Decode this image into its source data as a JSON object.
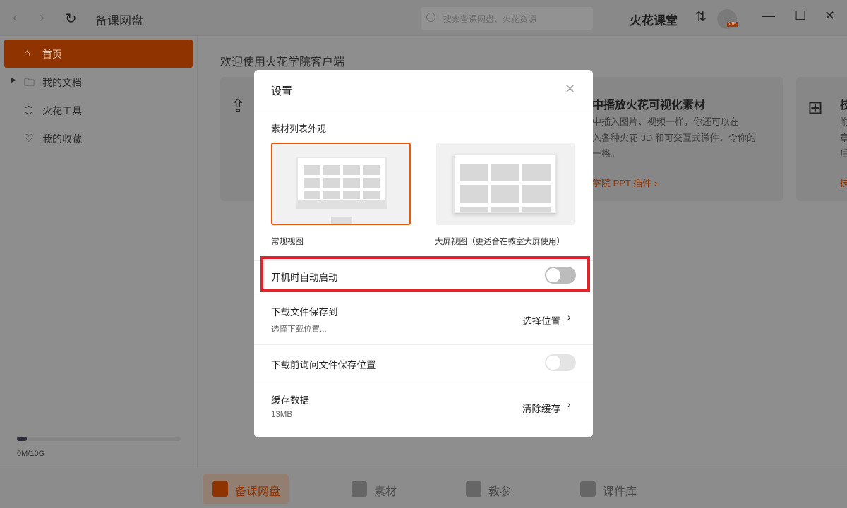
{
  "topbar": {
    "title": "备课网盘",
    "search_placeholder": "搜索备课网盘、火花资源",
    "brand": "火花课堂",
    "vip": "VIP"
  },
  "sidebar": {
    "items": [
      {
        "label": "首页",
        "icon": "home-icon",
        "active": true
      },
      {
        "label": "我的文档",
        "icon": "folder-icon"
      },
      {
        "label": "火花工具",
        "icon": "cube-icon"
      },
      {
        "label": "我的收藏",
        "icon": "heart-icon"
      }
    ],
    "storage": {
      "used_fraction": 0.02,
      "text": "0M/10G"
    }
  },
  "main": {
    "welcome": "欢迎使用火花学院客户端",
    "card1": {
      "title": "中播放火花可视化素材",
      "lines": [
        "中插入图片、视频一样，你还可以在",
        "入各种火花 3D 和可交互式微件，令你的",
        "一格。"
      ],
      "link": "学院 PPT 插件 ›"
    },
    "card2": {
      "title": "技",
      "lines": [
        "附",
        "章",
        "后"
      ],
      "link": "技"
    }
  },
  "bottom_tabs": [
    {
      "label": "备课网盘",
      "active": true
    },
    {
      "label": "素材"
    },
    {
      "label": "教参"
    },
    {
      "label": "课件库"
    }
  ],
  "modal": {
    "title": "设置",
    "section": "素材列表外观",
    "views": [
      {
        "label": "常规视图",
        "selected": true
      },
      {
        "label": "大屏视图（更适合在教室大屏使用）"
      }
    ],
    "autostart": {
      "label": "开机时自动启动",
      "on": false
    },
    "download": {
      "label": "下载文件保存到",
      "sub": "选择下载位置...",
      "action": "选择位置"
    },
    "ask": {
      "label": "下载前询问文件保存位置",
      "on": false
    },
    "cache": {
      "label": "缓存数据",
      "sub": "13MB",
      "action": "清除缓存"
    }
  },
  "colors": {
    "accent": "#f0560a",
    "highlight": "#e8202a"
  }
}
